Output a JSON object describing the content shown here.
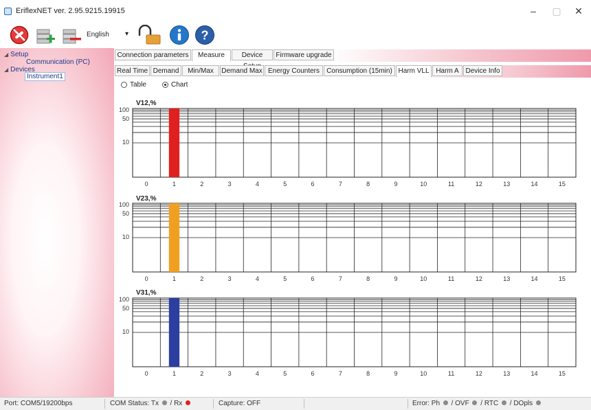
{
  "window": {
    "title": "EriflexNET ver. 2.95.9215.19915",
    "minimize": "–",
    "maximize": "▢",
    "close": "✕"
  },
  "toolbar": {
    "language": "English",
    "language_arrow": "▾"
  },
  "tree": {
    "setup": "Setup",
    "communication": "Communication (PC)",
    "devices": "Devices",
    "instrument": "Instrument1"
  },
  "top_tabs": [
    "Connection parameters",
    "Measure",
    "Device Setup",
    "Firmware upgrade"
  ],
  "top_tab_active": "Measure",
  "sub_tabs": [
    "Real Time",
    "Demand",
    "Min/Max",
    "Demand Max",
    "Energy Counters",
    "Consumption (15min)",
    "Harm VLL",
    "Harm A",
    "Device Info"
  ],
  "sub_tab_active": "Harm VLL",
  "view": {
    "table_label": "Table",
    "chart_label": "Chart",
    "selected": "Chart"
  },
  "chart_data": [
    {
      "type": "bar",
      "title": "V12,%",
      "color": "#e02020",
      "categories": [
        "0",
        "1",
        "2",
        "3",
        "4",
        "5",
        "6",
        "7",
        "8",
        "9",
        "10",
        "11",
        "12",
        "13",
        "14",
        "15"
      ],
      "values": [
        0,
        100,
        0,
        0,
        0,
        0,
        0,
        0,
        0,
        0,
        0,
        0,
        0,
        0,
        0,
        0
      ],
      "y_ticks": [
        "100",
        "50",
        "10"
      ],
      "yscale": "log",
      "grid": true
    },
    {
      "type": "bar",
      "title": "V23,%",
      "color": "#f0a020",
      "categories": [
        "0",
        "1",
        "2",
        "3",
        "4",
        "5",
        "6",
        "7",
        "8",
        "9",
        "10",
        "11",
        "12",
        "13",
        "14",
        "15"
      ],
      "values": [
        0,
        100,
        0,
        0,
        0,
        0,
        0,
        0,
        0,
        0,
        0,
        0,
        0,
        0,
        0,
        0
      ],
      "y_ticks": [
        "100",
        "50",
        "10"
      ],
      "yscale": "log",
      "grid": true
    },
    {
      "type": "bar",
      "title": "V31,%",
      "color": "#2c3fa0",
      "categories": [
        "0",
        "1",
        "2",
        "3",
        "4",
        "5",
        "6",
        "7",
        "8",
        "9",
        "10",
        "11",
        "12",
        "13",
        "14",
        "15"
      ],
      "values": [
        0,
        100,
        0,
        0,
        0,
        0,
        0,
        0,
        0,
        0,
        0,
        0,
        0,
        0,
        0,
        0
      ],
      "y_ticks": [
        "100",
        "50",
        "10"
      ],
      "yscale": "log",
      "grid": true
    }
  ],
  "status": {
    "port": "Port:  COM5/19200bps",
    "com_status": "COM Status:  Tx",
    "com_rx": "/ Rx",
    "capture": "Capture:  OFF",
    "error": "Error:  Ph",
    "ovf": "/ OVF",
    "rtc": "/ RTC",
    "dopls": "/ DOpls",
    "led_grey": "#8a8a8a",
    "led_red": "#e02020"
  }
}
